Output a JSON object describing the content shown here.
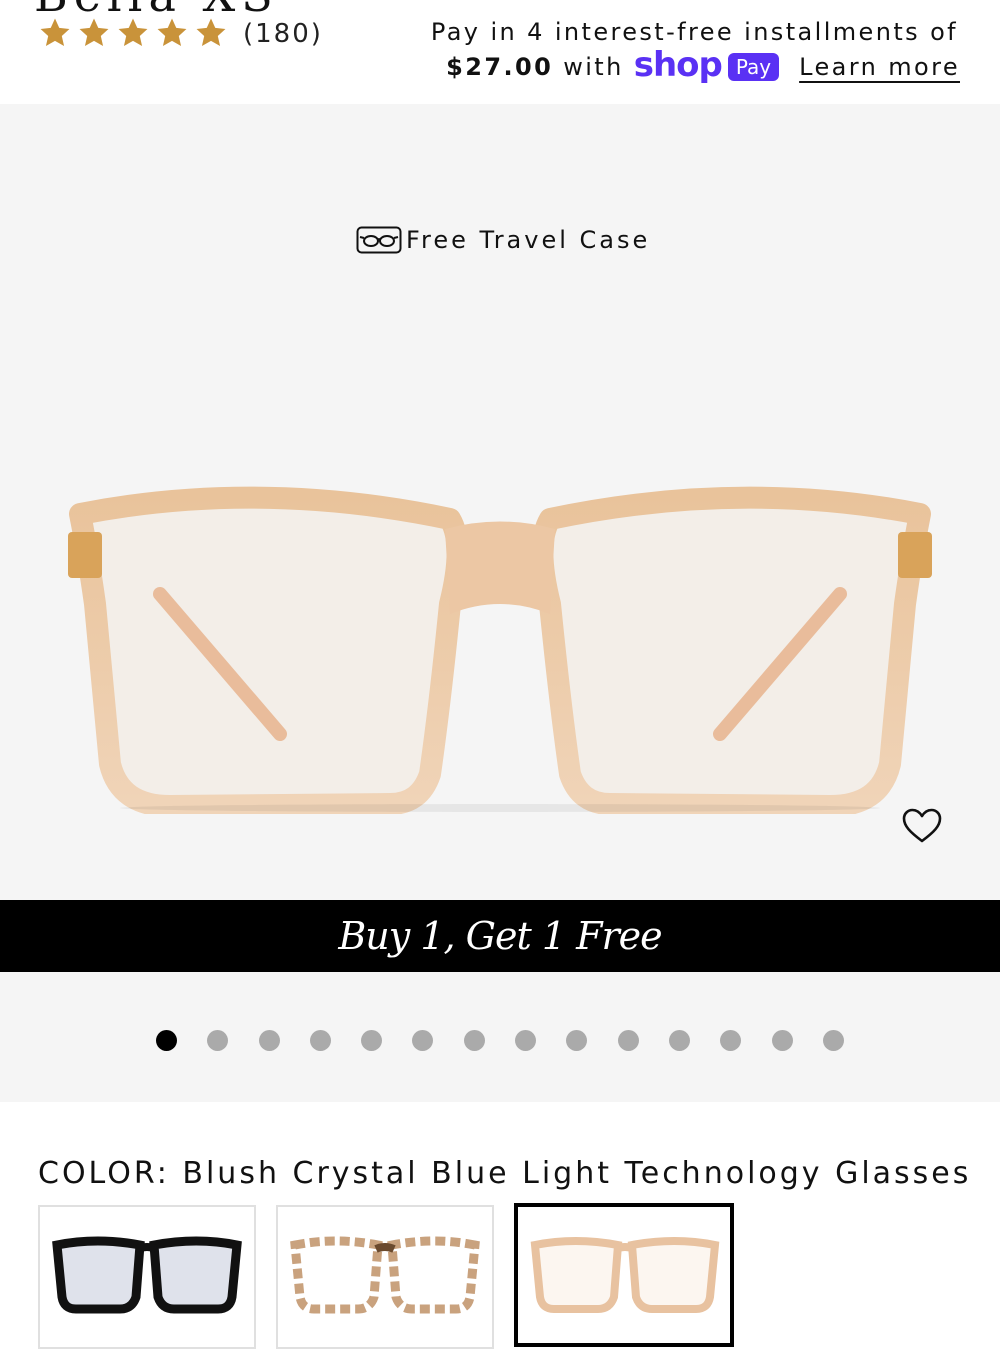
{
  "product": {
    "title": "Bella XS",
    "rating_stars": 5,
    "rating_count": "(180)"
  },
  "payment": {
    "line1": "Pay in 4 interest-free installments of",
    "amount": "$27.00",
    "with": "with",
    "provider_word": "shop",
    "provider_badge": "Pay",
    "learn_more": "Learn more",
    "brand_color": "#5a31f4"
  },
  "gallery": {
    "travel_case_text": "Free Travel Case",
    "promo_banner": "Buy 1, Get 1 Free",
    "slide_count": 14,
    "active_slide": 1
  },
  "color_selector": {
    "label": "COLOR: Blush Crystal Blue Light Technology Glasses",
    "swatches": [
      {
        "name": "black",
        "color": "#111111"
      },
      {
        "name": "tortoise",
        "color": "#c9a27e"
      },
      {
        "name": "blush-crystal",
        "color": "#e8c2a0",
        "selected": true
      }
    ]
  },
  "colors": {
    "star": "#c9933a",
    "banner_bg": "#000000",
    "gallery_bg": "#f5f5f5"
  }
}
